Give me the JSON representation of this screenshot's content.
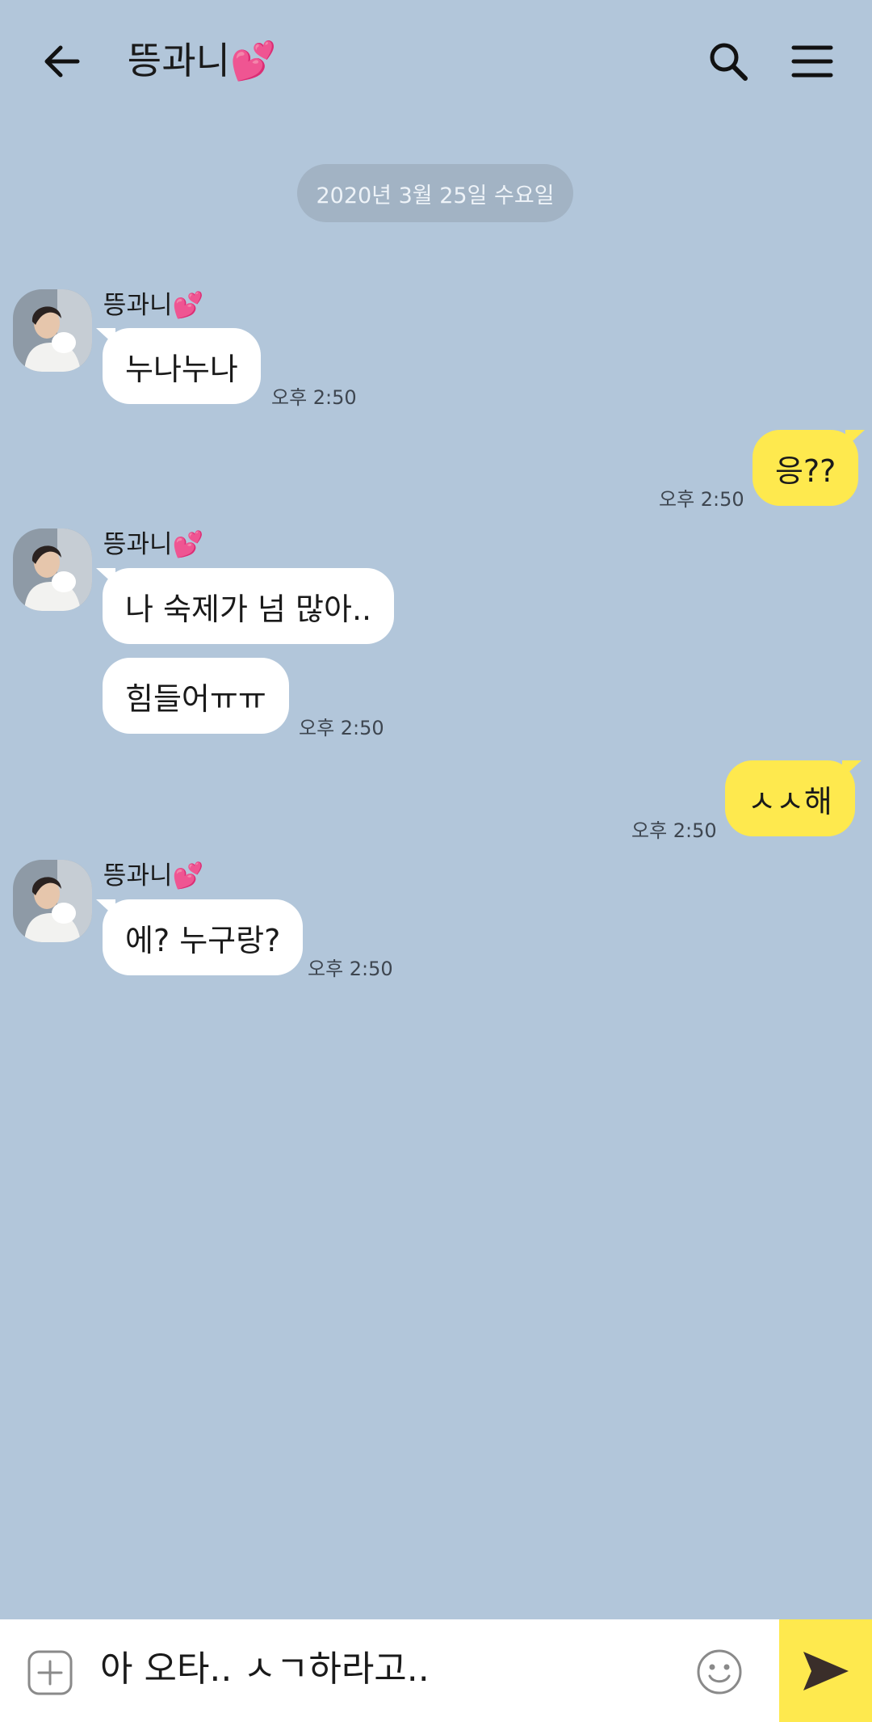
{
  "header": {
    "title": "뜽과니💕"
  },
  "date_divider": "2020년 3월 25일 수요일",
  "messages": [
    {
      "sender": "뜽과니💕",
      "text": "누나누나",
      "time": "오후 2:50"
    },
    {
      "text": "응??",
      "time": "오후 2:50"
    },
    {
      "sender": "뜽과니💕",
      "text": "나 숙제가 넘 많아..",
      "text2": "힘들어ㅠㅠ",
      "time": "오후 2:50"
    },
    {
      "text": "ㅅㅅ해",
      "time": "오후 2:50"
    },
    {
      "sender": "뜽과니💕",
      "text": "에? 누구랑?",
      "time": "오후 2:50"
    }
  ],
  "input": {
    "value": "아 오타.. ㅅㄱ하라고.."
  },
  "icons": {
    "back": "arrow-left-icon",
    "search": "search-icon",
    "menu": "hamburger-menu-icon",
    "plus": "plus-icon",
    "emoji": "smiley-icon",
    "send": "send-icon"
  },
  "colors": {
    "background": "#b2c6da",
    "incoming_bubble": "#ffffff",
    "outgoing_bubble": "#fee94e",
    "send_button": "#fee94e"
  }
}
